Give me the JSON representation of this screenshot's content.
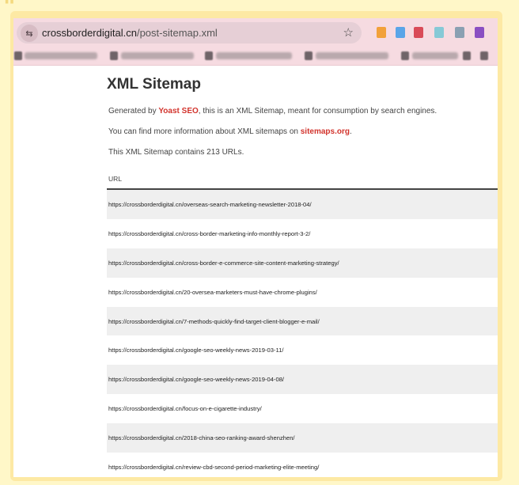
{
  "browser": {
    "address_host": "crossborderdigital.cn",
    "address_path": "/post-sitemap.xml",
    "extension_colors": [
      "#f2a13a",
      "#5aa5e8",
      "#d94b58",
      "#86c9d6",
      "#8aa0b2",
      "#8a4fc2"
    ]
  },
  "page": {
    "title": "XML Sitemap",
    "intro_prefix": "Generated by ",
    "intro_link": "Yoast SEO",
    "intro_suffix": ", this is an XML Sitemap, meant for consumption by search engines.",
    "info_prefix": "You can find more information about XML sitemaps on ",
    "info_link": "sitemaps.org",
    "info_suffix": ".",
    "count_text": "This XML Sitemap contains 213 URLs.",
    "table_header": "URL",
    "rows": [
      "https://crossborderdigital.cn/overseas-search-marketing-newsletter-2018-04/",
      "https://crossborderdigital.cn/cross-border-marketing-info-monthly-report-3-2/",
      "https://crossborderdigital.cn/cross-border-e-commerce-site-content-marketing-strategy/",
      "https://crossborderdigital.cn/20-oversea-marketers-must-have-chrome-plugins/",
      "https://crossborderdigital.cn/7-methods-quickly-find-target-client-blogger-e-mail/",
      "https://crossborderdigital.cn/google-seo-weekly-news-2019-03-11/",
      "https://crossborderdigital.cn/google-seo-weekly-news-2019-04-08/",
      "https://crossborderdigital.cn/focus-on-e-cigarette-industry/",
      "https://crossborderdigital.cn/2018-china-seo-ranking-award-shenzhen/",
      "https://crossborderdigital.cn/review-cbd-second-period-marketing-elite-meeting/"
    ]
  }
}
